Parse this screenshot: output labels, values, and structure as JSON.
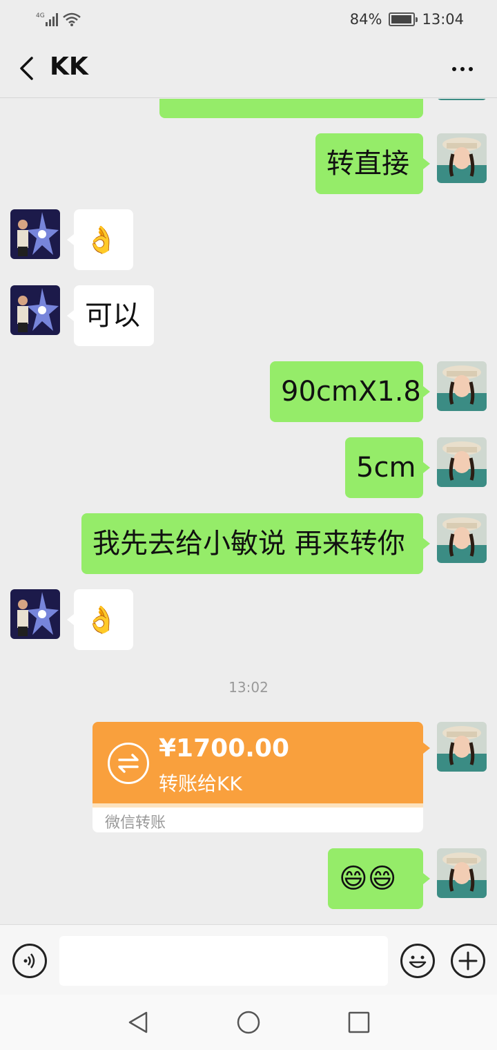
{
  "status_bar": {
    "network": "4G",
    "battery": "84%",
    "time": "13:04"
  },
  "header": {
    "title": "KK"
  },
  "messages": [
    {
      "side": "out",
      "text": "转直接"
    },
    {
      "side": "in",
      "text": "👌"
    },
    {
      "side": "in",
      "text": "可以"
    },
    {
      "side": "out",
      "text": "90cmX1.8"
    },
    {
      "side": "out",
      "text": "5cm"
    },
    {
      "side": "out",
      "text": "我先去给小敏说 再来转你"
    },
    {
      "side": "in",
      "text": "👌"
    },
    {
      "side": "out",
      "text": "😄😄"
    }
  ],
  "timestamp": "13:02",
  "transfer": {
    "amount": "¥1700.00",
    "to": "转账给KK",
    "footer": "微信转账"
  },
  "input": {
    "placeholder": ""
  }
}
